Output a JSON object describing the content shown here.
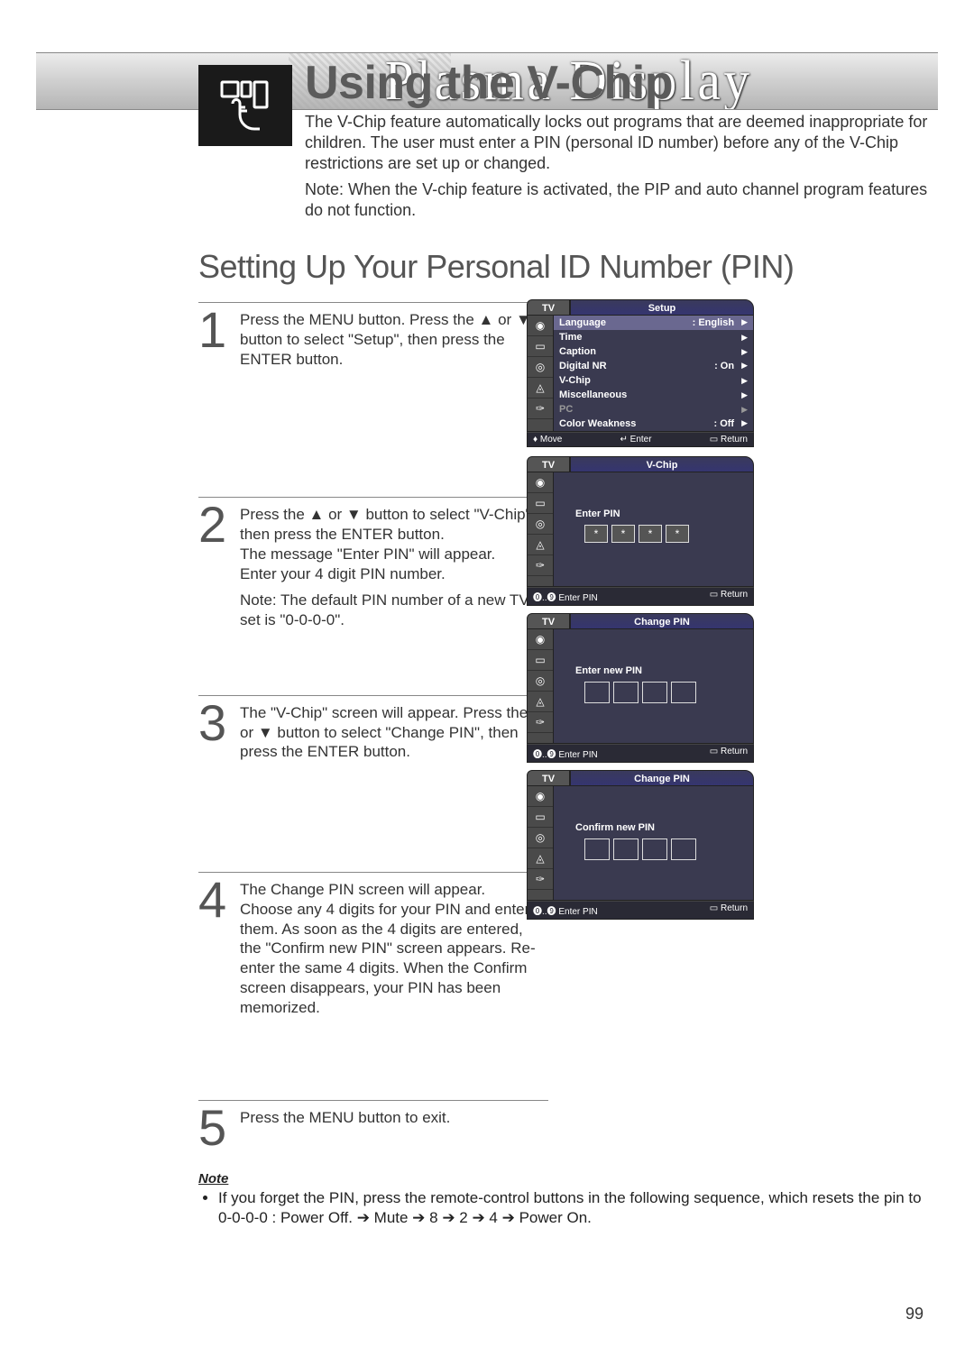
{
  "brand": "Plasma Display",
  "page_title": "Using the V-Chip",
  "intro_p1": "The V-Chip feature automatically locks out programs that are deemed inappropriate for children. The user must enter a PIN (personal ID number) before any of the V-Chip restrictions are set up or changed.",
  "intro_p2": "Note: When the V-chip feature is activated, the PIP and auto channel program features do not function.",
  "section_title": "Setting Up Your Personal ID Number (PIN)",
  "steps": {
    "s1": {
      "num": "1",
      "body": "Press the MENU button. Press the ▲ or ▼ button to select \"Setup\", then press the ENTER button."
    },
    "s2": {
      "num": "2",
      "body": "Press the ▲ or ▼ button to select \"V-Chip\", then press the ENTER button.\nThe message \"Enter PIN\" will appear.\nEnter your 4 digit PIN number.",
      "note": "Note: The default PIN number of a new TV set is \"0-0-0-0\"."
    },
    "s3": {
      "num": "3",
      "body": "The \"V-Chip\" screen will appear. Press the ▲ or ▼ button to select \"Change PIN\", then press the ENTER button."
    },
    "s4": {
      "num": "4",
      "body": "The Change PIN screen will appear.\nChoose any 4 digits for your PIN and enter them. As soon as the 4 digits are entered, the \"Confirm new PIN\" screen appears. Re-enter the same 4 digits. When the Confirm screen disappears, your PIN has been memorized."
    },
    "s5": {
      "num": "5",
      "body": "Press the MENU button to exit."
    }
  },
  "osd1": {
    "title": "Setup",
    "tv": "TV",
    "rows": [
      {
        "l": "Language",
        "r": ":  English",
        "sel": true
      },
      {
        "l": "Time",
        "r": ""
      },
      {
        "l": "Caption",
        "r": ""
      },
      {
        "l": "Digital NR",
        "r": ":  On"
      },
      {
        "l": "V-Chip",
        "r": ""
      },
      {
        "l": "Miscellaneous",
        "r": ""
      },
      {
        "l": "PC",
        "r": "",
        "dim": true
      },
      {
        "l": "Color Weakness",
        "r": ":  Off"
      }
    ],
    "foot": {
      "move": "Move",
      "enter": "Enter",
      "return": "Return"
    }
  },
  "osd2": {
    "title": "V-Chip",
    "tv": "TV",
    "label": "Enter PIN",
    "pins": [
      "*",
      "*",
      "*",
      "*"
    ],
    "foot": {
      "pin": "Enter PIN",
      "return": "Return"
    }
  },
  "osd3": {
    "title": "Change PIN",
    "tv": "TV",
    "label": "Enter new PIN",
    "foot": {
      "pin": "Enter PIN",
      "return": "Return"
    }
  },
  "osd4": {
    "title": "Change PIN",
    "tv": "TV",
    "label": "Confirm new PIN",
    "foot": {
      "pin": "Enter PIN",
      "return": "Return"
    }
  },
  "note_heading": "Note",
  "note_body": "If you forget the PIN, press the remote-control buttons in the following sequence, which resets the pin to  0-0-0-0 : Power Off. ➔ Mute ➔ 8 ➔ 2 ➔ 4 ➔ Power On.",
  "page_number": "99"
}
